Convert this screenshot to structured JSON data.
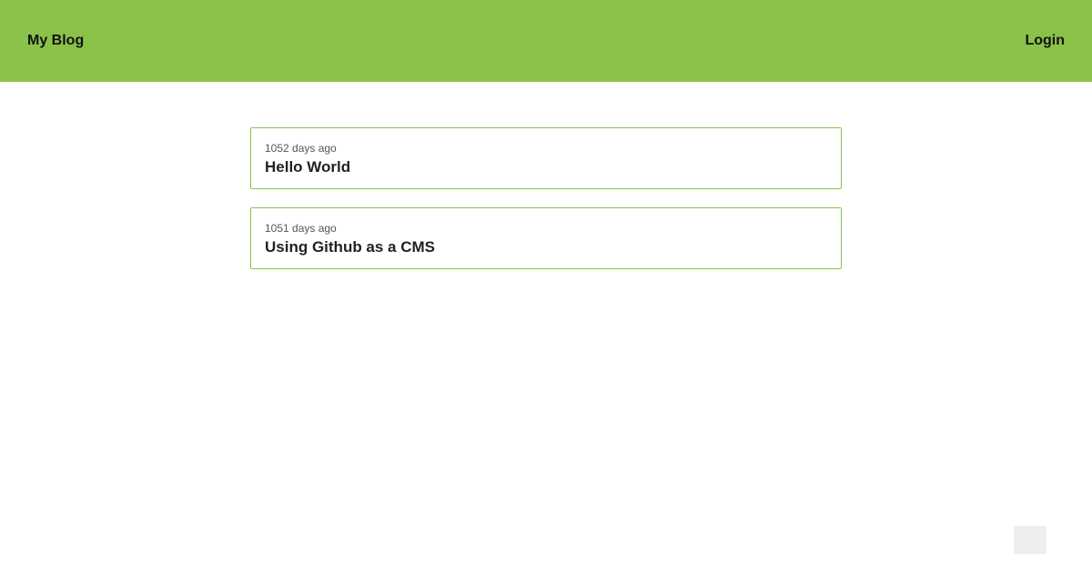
{
  "header": {
    "brand": "My Blog",
    "login_label": "Login",
    "color": "#8bc34a"
  },
  "posts": [
    {
      "age": "1052 days ago",
      "title": "Hello World"
    },
    {
      "age": "1051 days ago",
      "title": "Using Github as a CMS"
    }
  ]
}
